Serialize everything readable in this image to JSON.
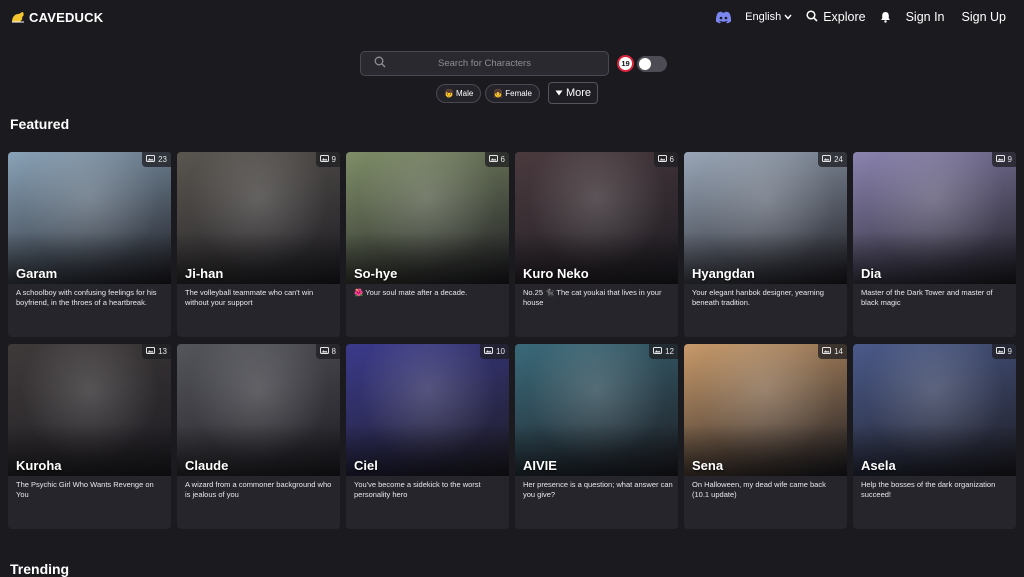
{
  "brand": {
    "name": "CAVEDUCK"
  },
  "nav": {
    "language": "English",
    "explore": "Explore",
    "sign_in": "Sign In",
    "sign_up": "Sign Up"
  },
  "search": {
    "placeholder": "Search for Characters",
    "value": ""
  },
  "age_filter": {
    "badge": "19",
    "toggle_on": false
  },
  "filters": {
    "male": "Male",
    "female": "Female",
    "more": "More"
  },
  "sections": {
    "featured": "Featured",
    "trending": "Trending"
  },
  "featured": [
    {
      "name": "Garam",
      "count": "23",
      "desc": "A schoolboy with confusing feelings for his boyfriend, in the throes of a heartbreak.",
      "color": "#8aa3b8"
    },
    {
      "name": "Ji-han",
      "count": "9",
      "desc": "The volleyball teammate who can't win without your support",
      "color": "#5a5650"
    },
    {
      "name": "So-hye",
      "count": "6",
      "desc": "🌺 Your soul mate after a decade.",
      "color": "#7f8e68"
    },
    {
      "name": "Kuro Neko",
      "count": "6",
      "desc": "No.25 🐈‍⬛ The cat youkai that lives in your house",
      "color": "#4a3a3e"
    },
    {
      "name": "Hyangdan",
      "count": "24",
      "desc": "Your elegant hanbok designer, yearning beneath tradition.",
      "color": "#9aa7b8"
    },
    {
      "name": "Dia",
      "count": "9",
      "desc": "Master of the Dark Tower and master of black magic",
      "color": "#8b84b0"
    },
    {
      "name": "Kuroha",
      "count": "13",
      "desc": "The Psychic Girl Who Wants Revenge on You",
      "color": "#3f3a3a"
    },
    {
      "name": "Claude",
      "count": "8",
      "desc": "A wizard from a commoner background who is jealous of you",
      "color": "#55565c"
    },
    {
      "name": "Ciel",
      "count": "10",
      "desc": "You've become a sidekick to the worst personality hero",
      "color": "#3b3a8c"
    },
    {
      "name": "AIVIE",
      "count": "12",
      "desc": "Her presence is a question; what answer can you give?",
      "color": "#3a6a7a"
    },
    {
      "name": "Sena",
      "count": "14",
      "desc": "On Halloween, my dead wife came back (10.1 update)",
      "color": "#c89a6a"
    },
    {
      "name": "Asela",
      "count": "9",
      "desc": "Help the bosses of the dark organization succeed!",
      "color": "#4a5a8a"
    }
  ]
}
